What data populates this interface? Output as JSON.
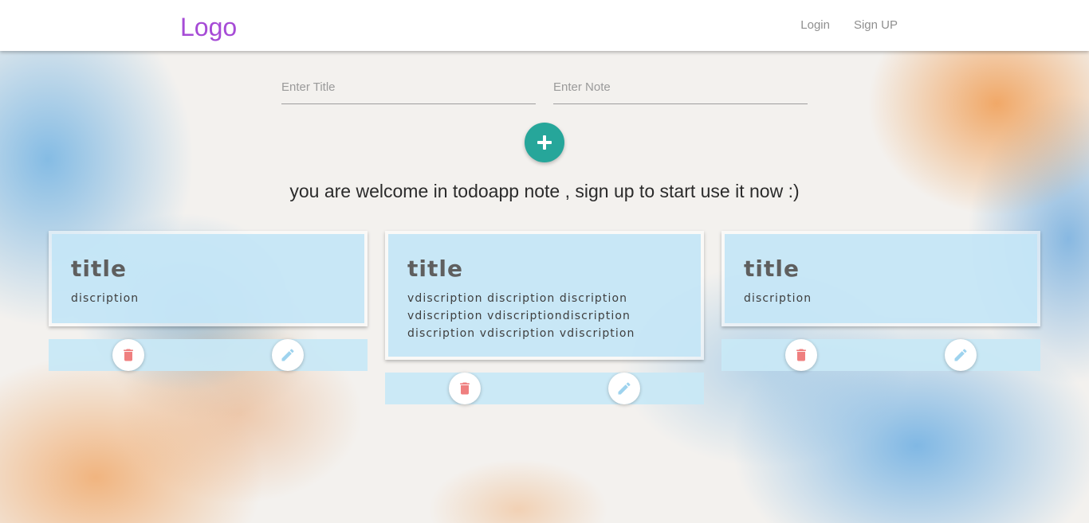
{
  "navbar": {
    "logo": "Logo",
    "links": [
      {
        "label": "Login"
      },
      {
        "label": "Sign UP"
      }
    ],
    "logo_color": "#a64bd6"
  },
  "form": {
    "title_placeholder": "Enter Title",
    "note_placeholder": "Enter Note",
    "add_icon": "plus-icon",
    "add_button_color": "#26a69a"
  },
  "welcome": {
    "text": "you are welcome in todoapp note , sign up to start use it now :)"
  },
  "notes": [
    {
      "title": "title",
      "description": "discription"
    },
    {
      "title": "title",
      "description": "vdiscription discription discription vdiscription vdiscriptiondiscription discription vdiscription vdiscription"
    },
    {
      "title": "title",
      "description": "discription"
    }
  ],
  "note_actions": {
    "delete_icon": "trash-icon",
    "edit_icon": "pencil-icon",
    "delete_color": "#ef7f7f",
    "edit_color": "#9ed3ee"
  }
}
